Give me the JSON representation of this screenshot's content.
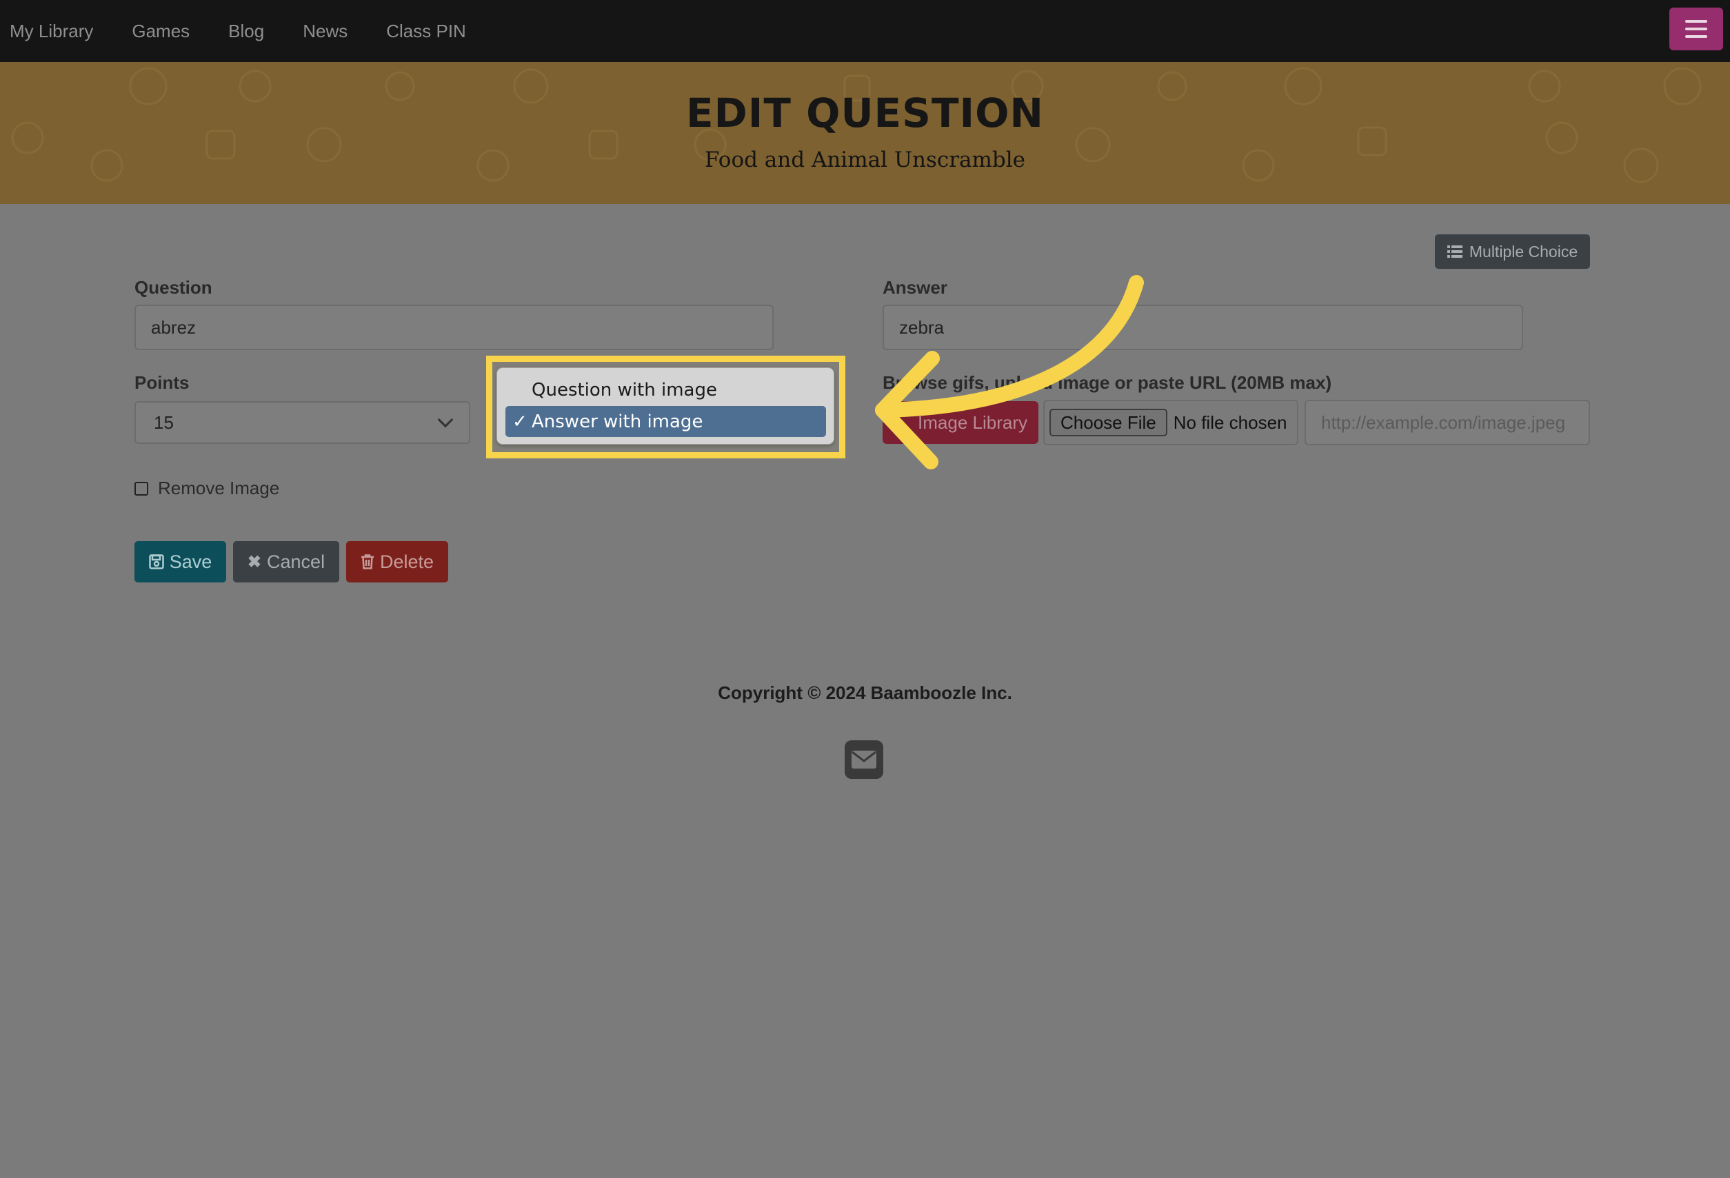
{
  "nav": {
    "items": [
      "My Library",
      "Games",
      "Blog",
      "News",
      "Class PIN"
    ],
    "menu_icon": "hamburger-icon"
  },
  "banner": {
    "title": "Edit Question",
    "subtitle": "Food and Animal Unscramble"
  },
  "form": {
    "multiple_choice_label": "Multiple Choice",
    "question_label": "Question",
    "question_value": "abrez",
    "answer_label": "Answer",
    "answer_value": "zebra",
    "points_label": "Points",
    "points_value": "15",
    "image_label": "Browse gifs, upload image or paste URL (20MB max)",
    "image_library_label": "Image Library",
    "choose_file_label": "Choose File",
    "no_file_label": "No file chosen",
    "url_placeholder": "http://example.com/image.jpeg",
    "remove_image_label": "Remove Image",
    "save_label": "Save",
    "cancel_label": "Cancel",
    "delete_label": "Delete"
  },
  "dropdown": {
    "options": [
      "Question with image",
      "Answer with image"
    ],
    "selected": "Answer with image"
  },
  "footer": {
    "copyright": "Copyright © 2024 Baamboozle Inc."
  },
  "colors": {
    "highlight": "#f7d44c",
    "selected_option": "#4e6f92",
    "save": "#0c4f5a",
    "delete": "#7c201c",
    "banner": "#7d6130"
  }
}
